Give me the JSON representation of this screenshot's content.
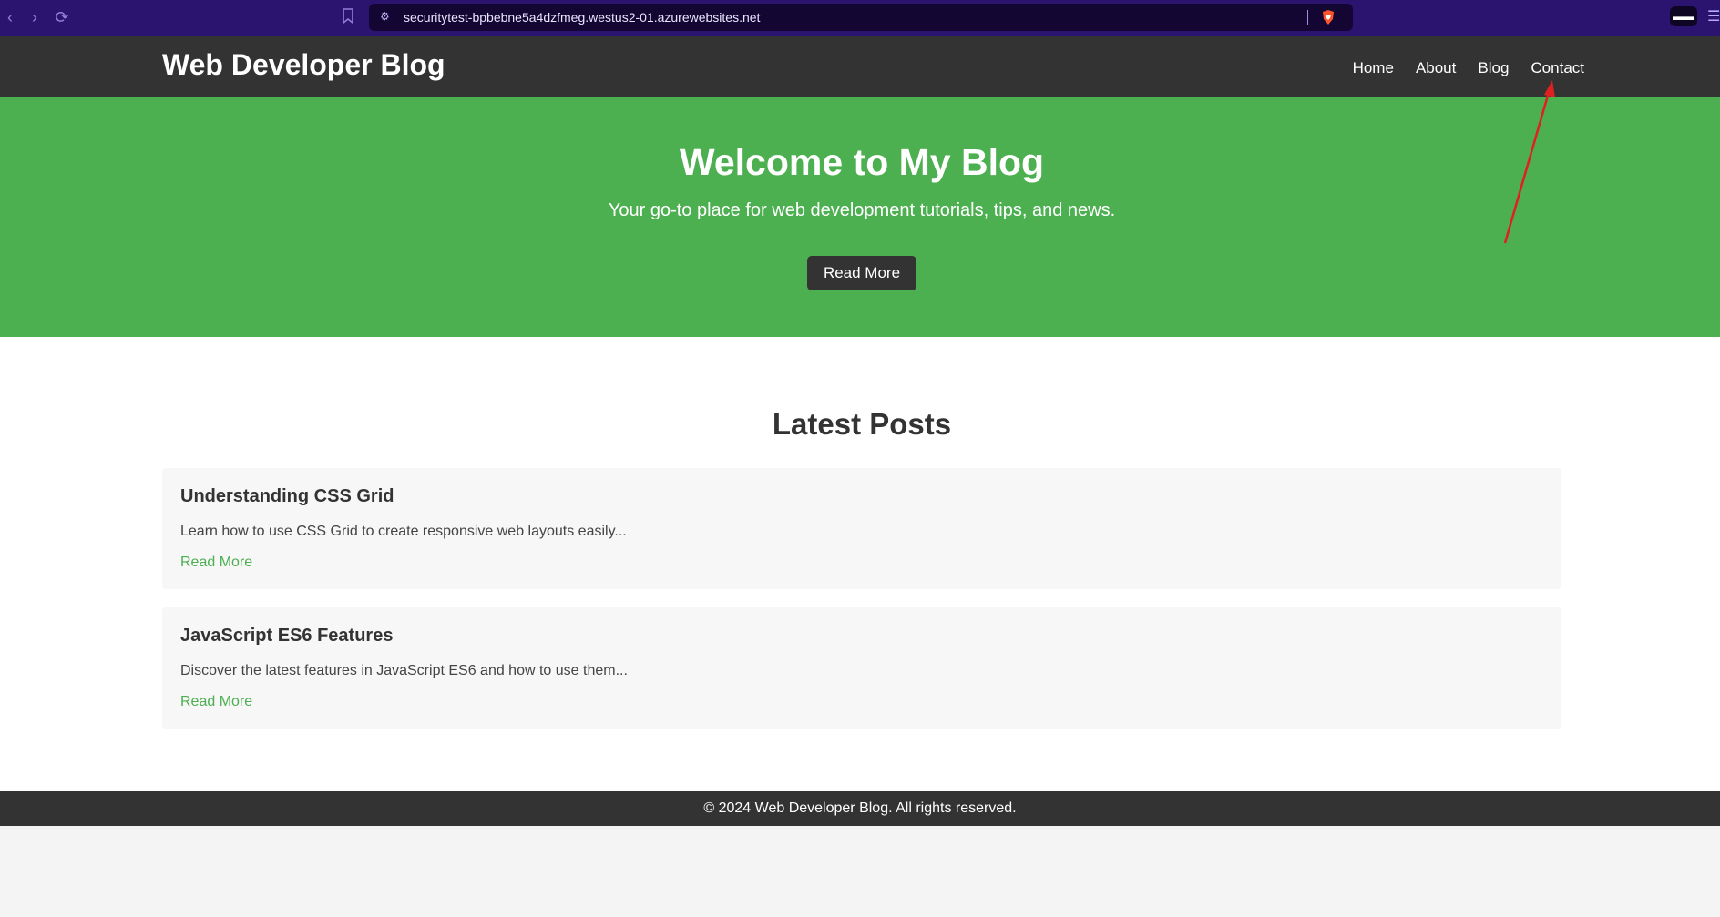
{
  "browser": {
    "url": "securitytest-bpbebne5a4dzfmeg.westus2-01.azurewebsites.net",
    "icons": [
      "back-icon",
      "forward-icon",
      "reload-icon",
      "bookmark-icon",
      "site-settings-icon",
      "brave-shield-icon",
      "reader-mode-icon",
      "menu-icon"
    ]
  },
  "header": {
    "title": "Web Developer Blog",
    "nav": [
      "Home",
      "About",
      "Blog",
      "Contact"
    ]
  },
  "hero": {
    "title": "Welcome to My Blog",
    "subtitle": "Your go-to place for web development tutorials, tips, and news.",
    "button": "Read More"
  },
  "latest": {
    "title": "Latest Posts",
    "posts": [
      {
        "title": "Understanding CSS Grid",
        "excerpt": "Learn how to use CSS Grid to create responsive web layouts easily...",
        "link": "Read More"
      },
      {
        "title": "JavaScript ES6 Features",
        "excerpt": "Discover the latest features in JavaScript ES6 and how to use them...",
        "link": "Read More"
      }
    ]
  },
  "footer": {
    "text": "© 2024 Web Developer Blog. All rights reserved."
  },
  "colors": {
    "hero_green": "#4caf50",
    "dark": "#333333",
    "browser_purple": "#2a1470",
    "annotation_red": "#e02020"
  }
}
